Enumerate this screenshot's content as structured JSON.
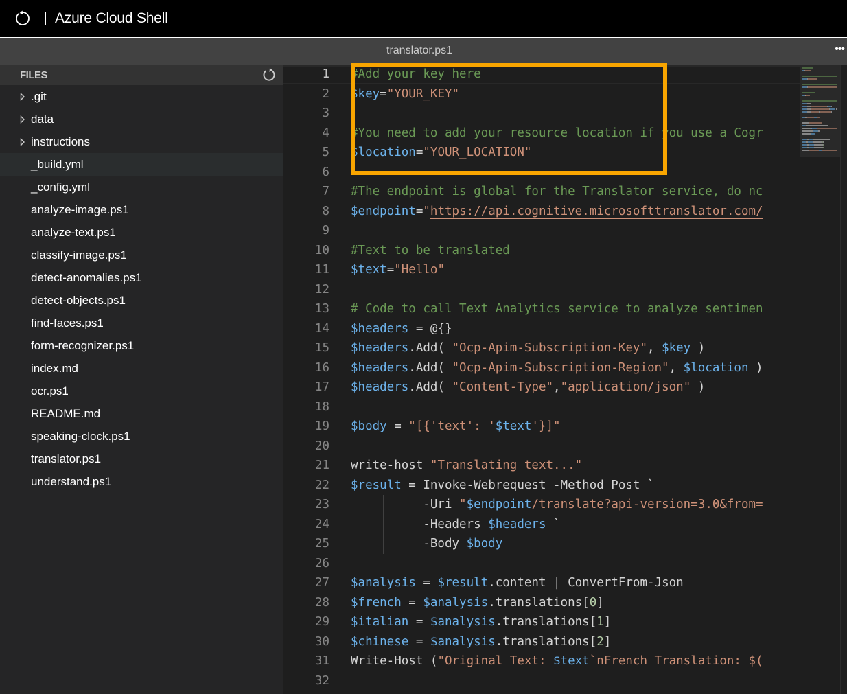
{
  "app": {
    "title": "Azure Cloud Shell",
    "refresh_icon": "refresh-icon"
  },
  "editor_tab": {
    "title": "translator.ps1",
    "more_label": "•••"
  },
  "sidebar": {
    "header": "FILES",
    "refresh_icon": "refresh-icon",
    "items": [
      {
        "label": ".git",
        "type": "folder",
        "selected": false
      },
      {
        "label": "data",
        "type": "folder",
        "selected": false
      },
      {
        "label": "instructions",
        "type": "folder",
        "selected": false
      },
      {
        "label": "_build.yml",
        "type": "file",
        "selected": true
      },
      {
        "label": "_config.yml",
        "type": "file",
        "selected": false
      },
      {
        "label": "analyze-image.ps1",
        "type": "file",
        "selected": false
      },
      {
        "label": "analyze-text.ps1",
        "type": "file",
        "selected": false
      },
      {
        "label": "classify-image.ps1",
        "type": "file",
        "selected": false
      },
      {
        "label": "detect-anomalies.ps1",
        "type": "file",
        "selected": false
      },
      {
        "label": "detect-objects.ps1",
        "type": "file",
        "selected": false
      },
      {
        "label": "find-faces.ps1",
        "type": "file",
        "selected": false
      },
      {
        "label": "form-recognizer.ps1",
        "type": "file",
        "selected": false
      },
      {
        "label": "index.md",
        "type": "file",
        "selected": false
      },
      {
        "label": "ocr.ps1",
        "type": "file",
        "selected": false
      },
      {
        "label": "README.md",
        "type": "file",
        "selected": false
      },
      {
        "label": "speaking-clock.ps1",
        "type": "file",
        "selected": false
      },
      {
        "label": "translator.ps1",
        "type": "file",
        "selected": false
      },
      {
        "label": "understand.ps1",
        "type": "file",
        "selected": false
      }
    ]
  },
  "code": {
    "active_line": 1,
    "colors": {
      "comment": "#6a9955",
      "variable": "#6cb2eb",
      "string": "#ce9178",
      "number": "#b5cea8",
      "plain": "#d4d4d4",
      "highlight_box": "#f8a500"
    },
    "lines": [
      {
        "n": "1",
        "tokens": [
          [
            "comment",
            "#Add your key here"
          ]
        ]
      },
      {
        "n": "2",
        "tokens": [
          [
            "var",
            "$key"
          ],
          [
            "plain",
            "="
          ],
          [
            "str",
            "\"YOUR_KEY\""
          ]
        ]
      },
      {
        "n": "3",
        "tokens": []
      },
      {
        "n": "4",
        "tokens": [
          [
            "comment",
            "#You need to add your resource location if you use a Cogr"
          ]
        ]
      },
      {
        "n": "5",
        "tokens": [
          [
            "var",
            "$location"
          ],
          [
            "plain",
            "="
          ],
          [
            "str",
            "\"YOUR_LOCATION\""
          ]
        ]
      },
      {
        "n": "6",
        "tokens": []
      },
      {
        "n": "7",
        "tokens": [
          [
            "comment",
            "#The endpoint is global for the Translator service, do nc"
          ]
        ]
      },
      {
        "n": "8",
        "tokens": [
          [
            "var",
            "$endpoint"
          ],
          [
            "plain",
            "="
          ],
          [
            "str",
            "\""
          ],
          [
            "url",
            "https://api.cognitive.microsofttranslator.com/"
          ]
        ]
      },
      {
        "n": "9",
        "tokens": []
      },
      {
        "n": "10",
        "tokens": [
          [
            "comment",
            "#Text to be translated"
          ]
        ]
      },
      {
        "n": "11",
        "tokens": [
          [
            "var",
            "$text"
          ],
          [
            "plain",
            "="
          ],
          [
            "str",
            "\"Hello\""
          ]
        ]
      },
      {
        "n": "12",
        "tokens": []
      },
      {
        "n": "13",
        "tokens": [
          [
            "comment",
            "# Code to call Text Analytics service to analyze sentimen"
          ]
        ]
      },
      {
        "n": "14",
        "tokens": [
          [
            "var",
            "$headers"
          ],
          [
            "plain",
            " = @{}"
          ]
        ]
      },
      {
        "n": "15",
        "tokens": [
          [
            "var",
            "$headers"
          ],
          [
            "plain",
            ".Add( "
          ],
          [
            "str",
            "\"Ocp-Apim-Subscription-Key\""
          ],
          [
            "plain",
            ", "
          ],
          [
            "var",
            "$key"
          ],
          [
            "plain",
            " )"
          ]
        ]
      },
      {
        "n": "16",
        "tokens": [
          [
            "var",
            "$headers"
          ],
          [
            "plain",
            ".Add( "
          ],
          [
            "str",
            "\"Ocp-Apim-Subscription-Region\""
          ],
          [
            "plain",
            ", "
          ],
          [
            "var",
            "$location"
          ],
          [
            "plain",
            " )"
          ]
        ]
      },
      {
        "n": "17",
        "tokens": [
          [
            "var",
            "$headers"
          ],
          [
            "plain",
            ".Add( "
          ],
          [
            "str",
            "\"Content-Type\""
          ],
          [
            "plain",
            ","
          ],
          [
            "str",
            "\"application/json\""
          ],
          [
            "plain",
            " )"
          ]
        ]
      },
      {
        "n": "18",
        "tokens": []
      },
      {
        "n": "19",
        "tokens": [
          [
            "var",
            "$body"
          ],
          [
            "plain",
            " = "
          ],
          [
            "str",
            "\"[{'text': '"
          ],
          [
            "var",
            "$text"
          ],
          [
            "str",
            "'}]\""
          ]
        ]
      },
      {
        "n": "20",
        "tokens": []
      },
      {
        "n": "21",
        "tokens": [
          [
            "plain",
            "write-host "
          ],
          [
            "str",
            "\"Translating text...\""
          ]
        ]
      },
      {
        "n": "22",
        "tokens": [
          [
            "var",
            "$result"
          ],
          [
            "plain",
            " = Invoke-Webrequest -Method Post `"
          ]
        ]
      },
      {
        "n": "23",
        "tokens": [
          [
            "plain",
            "          -Uri "
          ],
          [
            "str",
            "\""
          ],
          [
            "var",
            "$endpoint"
          ],
          [
            "str",
            "/translate?api-version=3.0&from="
          ]
        ]
      },
      {
        "n": "24",
        "tokens": [
          [
            "plain",
            "          -Headers "
          ],
          [
            "var",
            "$headers"
          ],
          [
            "plain",
            " `"
          ]
        ]
      },
      {
        "n": "25",
        "tokens": [
          [
            "plain",
            "          -Body "
          ],
          [
            "var",
            "$body"
          ]
        ]
      },
      {
        "n": "26",
        "tokens": []
      },
      {
        "n": "27",
        "tokens": [
          [
            "var",
            "$analysis"
          ],
          [
            "plain",
            " = "
          ],
          [
            "var",
            "$result"
          ],
          [
            "plain",
            ".content | ConvertFrom-Json"
          ]
        ]
      },
      {
        "n": "28",
        "tokens": [
          [
            "var",
            "$french"
          ],
          [
            "plain",
            " = "
          ],
          [
            "var",
            "$analysis"
          ],
          [
            "plain",
            ".translations["
          ],
          [
            "num",
            "0"
          ],
          [
            "plain",
            "]"
          ]
        ]
      },
      {
        "n": "29",
        "tokens": [
          [
            "var",
            "$italian"
          ],
          [
            "plain",
            " = "
          ],
          [
            "var",
            "$analysis"
          ],
          [
            "plain",
            ".translations["
          ],
          [
            "num",
            "1"
          ],
          [
            "plain",
            "]"
          ]
        ]
      },
      {
        "n": "30",
        "tokens": [
          [
            "var",
            "$chinese"
          ],
          [
            "plain",
            " = "
          ],
          [
            "var",
            "$analysis"
          ],
          [
            "plain",
            ".translations["
          ],
          [
            "num",
            "2"
          ],
          [
            "plain",
            "]"
          ]
        ]
      },
      {
        "n": "31",
        "tokens": [
          [
            "plain",
            "Write-Host ("
          ],
          [
            "str",
            "\"Original Text: "
          ],
          [
            "var",
            "$text"
          ],
          [
            "str",
            "`nFrench Translation: $("
          ]
        ]
      },
      {
        "n": "32",
        "tokens": []
      }
    ]
  }
}
